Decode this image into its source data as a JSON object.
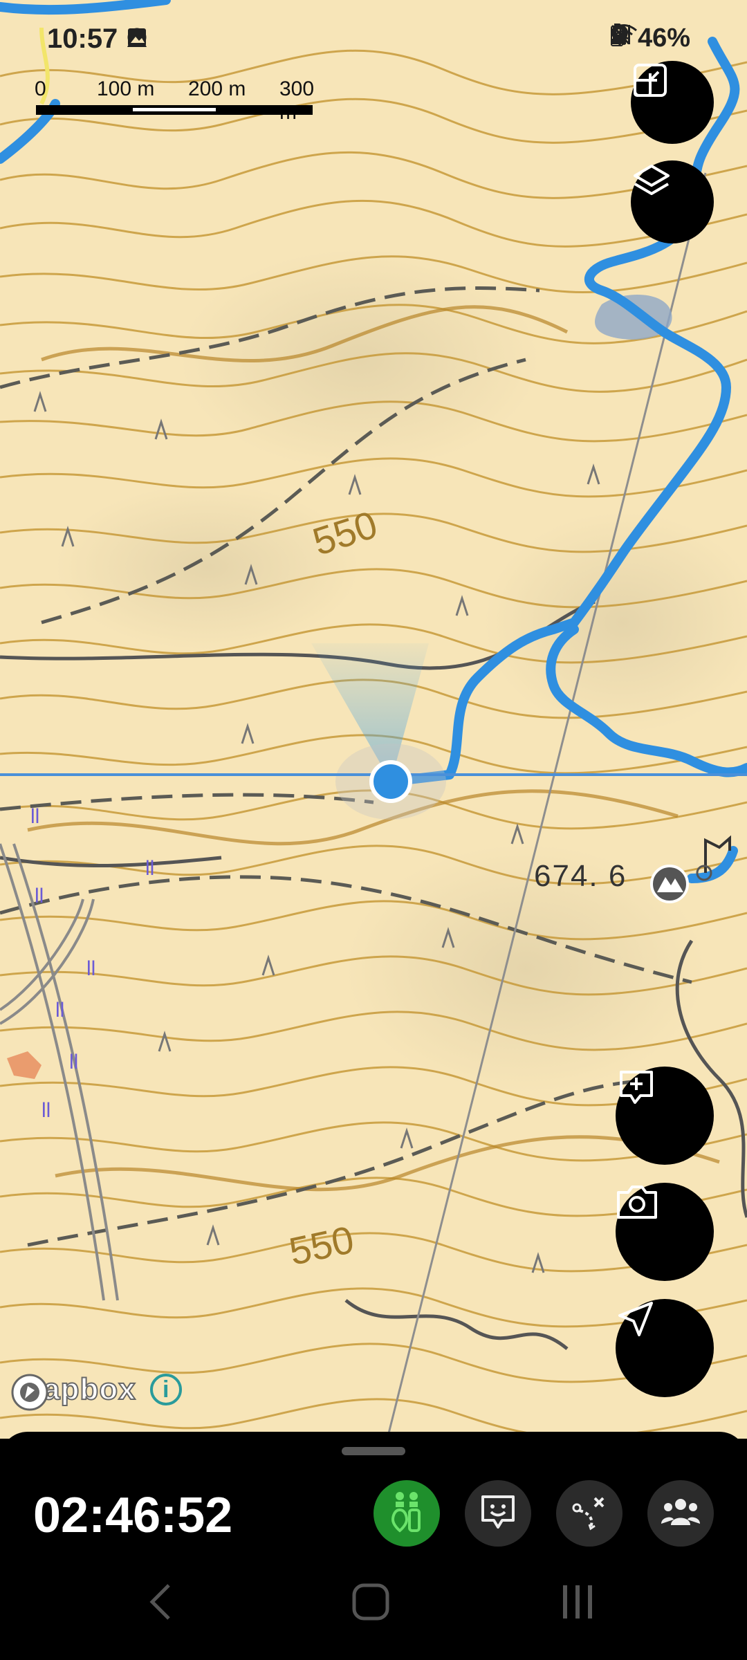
{
  "status_bar": {
    "time": "10:57",
    "battery": "46%",
    "icons_left": [
      "sync-icon",
      "navigation-alert-icon",
      "image-icon"
    ],
    "icons_right": [
      "location-pin-icon",
      "wifi-icon",
      "bluetooth-off-icon",
      "signal-icon",
      "battery-icon"
    ]
  },
  "scale_bar": {
    "labels": [
      "0",
      "100 m",
      "200 m",
      "300 m"
    ]
  },
  "map": {
    "contour_labels": [
      "550",
      "550"
    ],
    "peak_elevation": "674. 6",
    "attribution": "mapbox",
    "colors": {
      "background": "#f7e5b8",
      "contour": "#c79a3a",
      "trail": "#2f8fe0",
      "road": "#555555"
    }
  },
  "map_buttons": {
    "expand": "expand-icon",
    "layers": "layers-icon",
    "add_note": "add-note-icon",
    "camera": "camera-icon",
    "locate": "navigation-arrow-icon"
  },
  "bottom_sheet": {
    "elapsed_time": "02:46:52",
    "buttons": [
      "hiker-group-icon",
      "chat-face-icon",
      "route-edit-icon",
      "people-icon"
    ],
    "active_color": "#1f8f2c"
  }
}
